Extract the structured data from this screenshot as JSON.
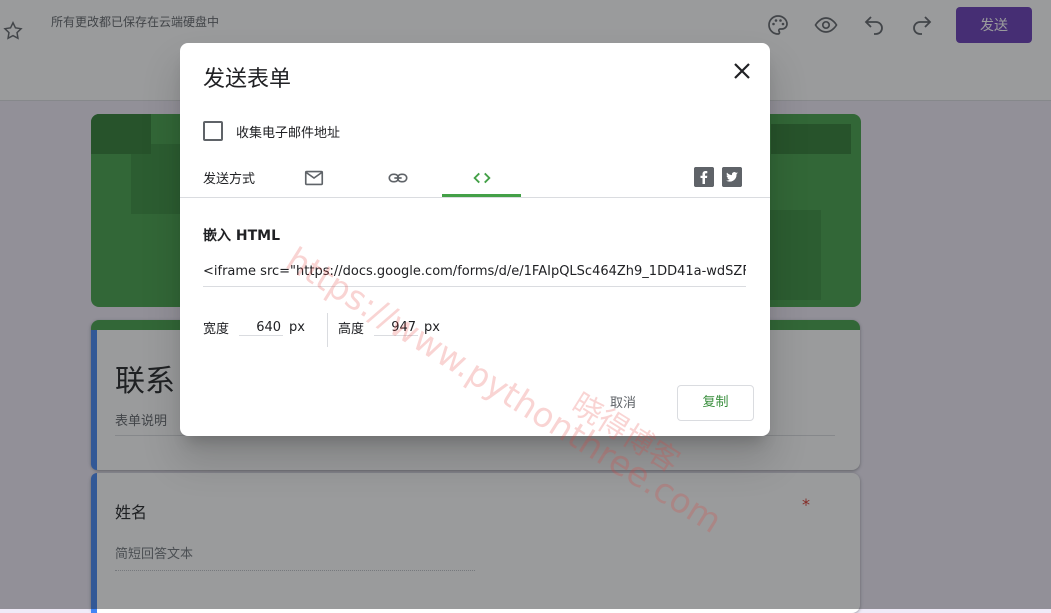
{
  "topbar": {
    "save_status": "所有更改都已保存在云端硬盘中",
    "send_label": "发送",
    "icons": [
      "star-icon",
      "palette-icon",
      "preview-eye-icon",
      "undo-icon",
      "redo-icon"
    ]
  },
  "form": {
    "title": "联系",
    "description": "表单说明",
    "question_title": "姓名",
    "required_mark": "*",
    "answer_placeholder": "简短回答文本"
  },
  "dialog": {
    "title": "发送表单",
    "collect_email_label": "收集电子邮件地址",
    "send_via_label": "发送方式",
    "tabs": [
      {
        "name": "email",
        "icon": "mail-icon",
        "active": false
      },
      {
        "name": "link",
        "icon": "link-icon",
        "active": false
      },
      {
        "name": "embed",
        "icon": "code-icon",
        "active": true
      }
    ],
    "social": [
      "facebook-icon",
      "twitter-icon"
    ],
    "embed_label": "嵌入 HTML",
    "embed_code": "<iframe src=\"https://docs.google.com/forms/d/e/1FAIpQLSc464Zh9_1DD41a-wdSZF",
    "width_label": "宽度",
    "width_value": "640",
    "height_label": "高度",
    "height_value": "947",
    "unit": "px",
    "cancel_label": "取消",
    "copy_label": "复制"
  },
  "watermark": {
    "url": "https://www.pythonthree.com",
    "text": "晓得博客"
  },
  "colors": {
    "accent_purple": "#673ab7",
    "accent_green": "#43a047",
    "required_red": "#d93025"
  }
}
